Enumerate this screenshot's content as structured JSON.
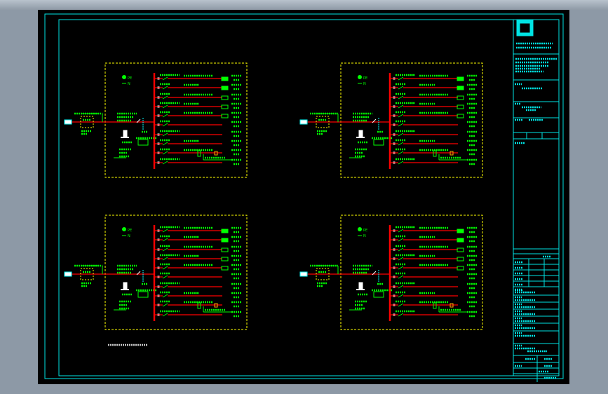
{
  "viewer": {
    "background_color": "#8d99a6",
    "sheet_color": "#000000"
  },
  "colors": {
    "frame": "#00e5e5",
    "panel_border": "#ffff00",
    "busbar": "#ff0000",
    "annotation": "#00ff00",
    "accent_cyan": "#00ffff",
    "white": "#ffffff"
  },
  "panels": [
    {
      "id": "top-left",
      "feeders": 10
    },
    {
      "id": "top-right",
      "feeders": 10
    },
    {
      "id": "bottom-left",
      "feeders": 10
    },
    {
      "id": "bottom-right",
      "feeders": 10
    }
  ],
  "panel_labels": {
    "pe": "PE",
    "n": "N"
  },
  "title_block": {
    "logo_icon": "company-logo-icon"
  }
}
